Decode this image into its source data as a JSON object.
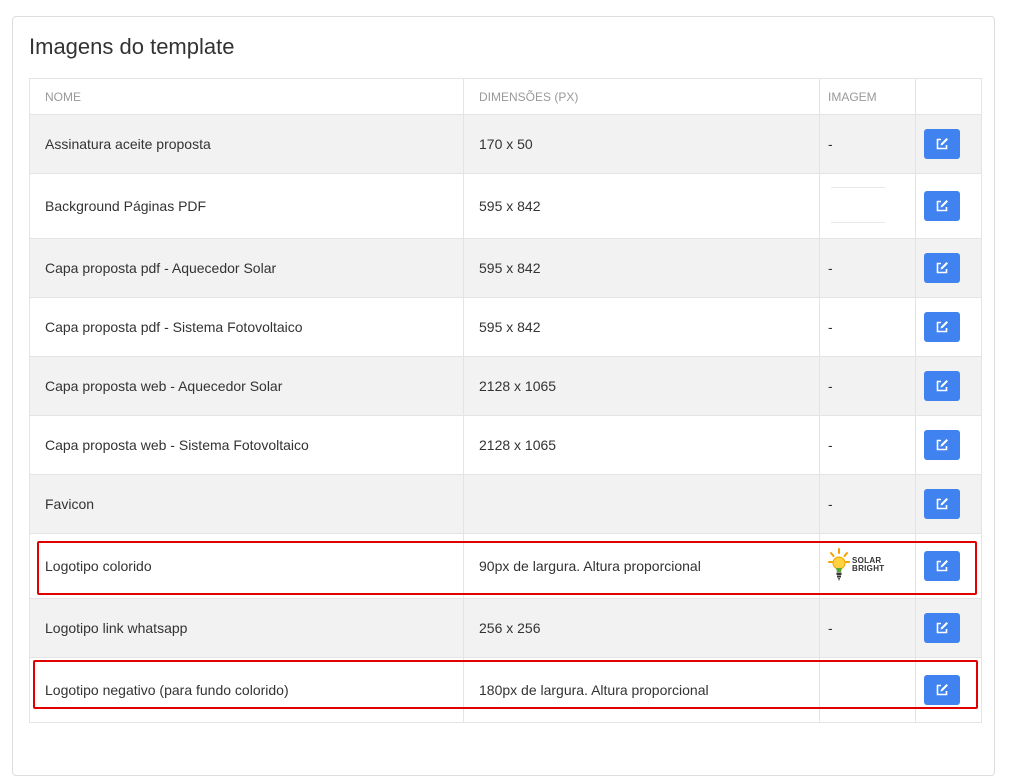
{
  "panel": {
    "title": "Imagens do template"
  },
  "table": {
    "headers": {
      "name": "NOME",
      "dimensions": "DIMENSÕES (PX)",
      "image": "IMAGEM"
    },
    "rows": [
      {
        "name": "Assinatura aceite proposta",
        "dimensions": "170 x 50",
        "image": "-"
      },
      {
        "name": "Background Páginas PDF",
        "dimensions": "595 x 842",
        "image": ""
      },
      {
        "name": "Capa proposta pdf - Aquecedor Solar",
        "dimensions": "595 x 842",
        "image": "-"
      },
      {
        "name": "Capa proposta pdf - Sistema Fotovoltaico",
        "dimensions": "595 x 842",
        "image": "-"
      },
      {
        "name": "Capa proposta web - Aquecedor Solar",
        "dimensions": "2128 x 1065",
        "image": "-"
      },
      {
        "name": "Capa proposta web - Sistema Fotovoltaico",
        "dimensions": "2128 x 1065",
        "image": "-"
      },
      {
        "name": "Favicon",
        "dimensions": "",
        "image": "-"
      },
      {
        "name": "Logotipo colorido",
        "dimensions": "90px de largura. Altura proporcional",
        "image": ""
      },
      {
        "name": "Logotipo link whatsapp",
        "dimensions": "256 x 256",
        "image": "-"
      },
      {
        "name": "Logotipo negativo (para fundo colorido)",
        "dimensions": "180px de largura. Altura proporcional",
        "image": ""
      }
    ]
  },
  "logo_thumb": {
    "line1": "SOLAR",
    "line2": "BRIGHT",
    "icon": "lightbulb-sun-icon"
  },
  "icons": {
    "edit": "edit-icon"
  },
  "colors": {
    "accent": "#3f82f0",
    "highlight": "#e00000"
  }
}
